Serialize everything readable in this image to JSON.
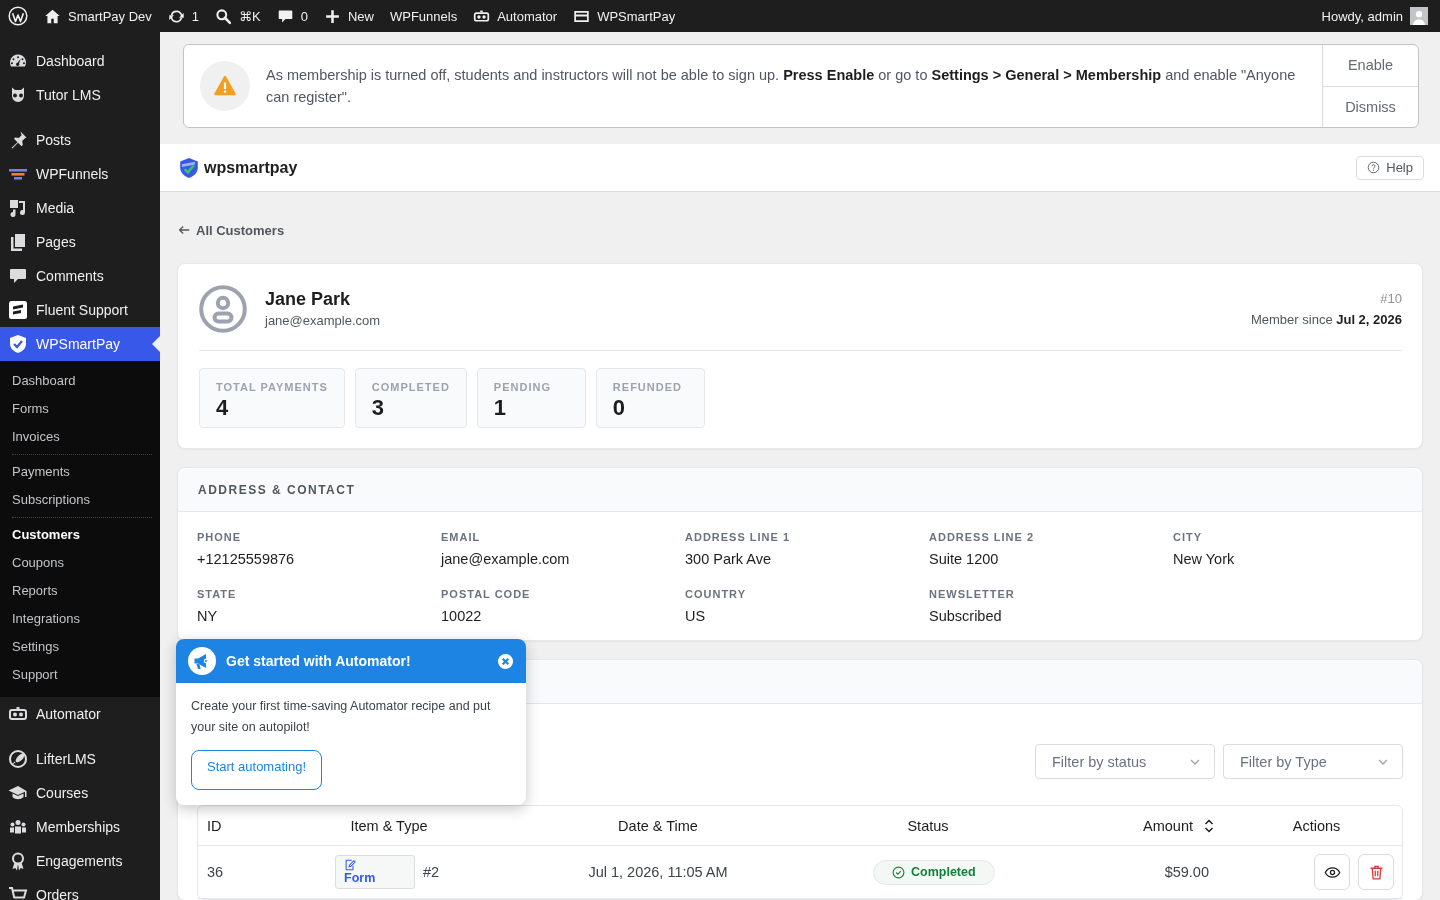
{
  "admin_bar": {
    "items": [
      {
        "label": "SmartPay Dev"
      },
      {
        "label": "1"
      },
      {
        "label": "⌘K"
      },
      {
        "label": "0"
      },
      {
        "label": "New"
      },
      {
        "label": "WPFunnels"
      },
      {
        "label": "Automator"
      },
      {
        "label": "WPSmartPay"
      }
    ],
    "account": "Howdy, admin"
  },
  "sidebar": {
    "groups": [
      {
        "items": [
          {
            "label": "Dashboard",
            "selected": false
          },
          {
            "label": "Tutor LMS",
            "selected": false
          }
        ]
      },
      {
        "items": [
          {
            "label": "Posts",
            "selected": false
          },
          {
            "label": "WPFunnels",
            "selected": false
          },
          {
            "label": "Media",
            "selected": false
          },
          {
            "label": "Pages",
            "selected": false
          },
          {
            "label": "Comments",
            "selected": false
          },
          {
            "label": "Fluent Support",
            "selected": false
          },
          {
            "label": "WPSmartPay",
            "selected": true,
            "children": [
              [
                {
                  "label": "Dashboard",
                  "selected": false
                },
                {
                  "label": "Forms",
                  "selected": false
                },
                {
                  "label": "Invoices",
                  "selected": false
                }
              ],
              [
                {
                  "label": "Payments",
                  "selected": false
                },
                {
                  "label": "Subscriptions",
                  "selected": false
                }
              ],
              [
                {
                  "label": "Customers",
                  "selected": true
                },
                {
                  "label": "Coupons",
                  "selected": false
                },
                {
                  "label": "Reports",
                  "selected": false
                },
                {
                  "label": "Integrations",
                  "selected": false
                },
                {
                  "label": "Settings",
                  "selected": false
                },
                {
                  "label": "Support",
                  "selected": false
                }
              ]
            ]
          },
          {
            "label": "Automator",
            "selected": false
          }
        ]
      },
      {
        "items": [
          {
            "label": "LifterLMS",
            "selected": false
          },
          {
            "label": "Courses",
            "selected": false
          },
          {
            "label": "Memberships",
            "selected": false
          },
          {
            "label": "Engagements",
            "selected": false
          },
          {
            "label": "Orders",
            "selected": false
          }
        ]
      }
    ]
  },
  "notice": {
    "message": "As membership is turned off, students and instructors will not be able to sign up. **Press Enable** or go to **Settings > General > Membership** and enable \"Anyone can register\".",
    "buttons": [
      "Enable",
      "Dismiss"
    ]
  },
  "page_header": {
    "logo_text": "wpsmartpay",
    "help": "Help"
  },
  "back_link": "All Customers",
  "customer": {
    "name": "Jane Park",
    "email": "jane@example.com",
    "number": "#10",
    "member_since": "Member since **Jul 2, 2026**",
    "stats": [
      {
        "label": "TOTAL PAYMENTS",
        "value": "4"
      },
      {
        "label": "COMPLETED",
        "value": "3"
      },
      {
        "label": "PENDING",
        "value": "1"
      },
      {
        "label": "REFUNDED",
        "value": "0"
      }
    ]
  },
  "address": {
    "title": "ADDRESS & CONTACT",
    "fields": [
      {
        "label": "PHONE",
        "value": "+12125559876"
      },
      {
        "label": "EMAIL",
        "value": "jane@example.com"
      },
      {
        "label": "ADDRESS LINE 1",
        "value": "300 Park Ave"
      },
      {
        "label": "ADDRESS LINE 2",
        "value": "Suite 1200"
      },
      {
        "label": "CITY",
        "value": "New York"
      },
      {
        "label": "STATE",
        "value": "NY"
      },
      {
        "label": "POSTAL CODE",
        "value": "10022"
      },
      {
        "label": "COUNTRY",
        "value": "US"
      },
      {
        "label": "NEWSLETTER",
        "value": "Subscribed"
      }
    ]
  },
  "payments": {
    "filters": [
      {
        "placeholder": "Filter by status"
      },
      {
        "placeholder": "Filter by Type"
      }
    ],
    "table": {
      "columns": [
        {
          "label": "ID",
          "sortable": false
        },
        {
          "label": "Item & Type",
          "sortable": false
        },
        {
          "label": "Date & Time",
          "sortable": false
        },
        {
          "label": "Status",
          "sortable": false
        },
        {
          "label": "Amount",
          "sortable": true
        },
        {
          "label": "Actions",
          "sortable": false
        }
      ],
      "rows": [
        {
          "id": "36",
          "type": "Form",
          "item": "#2",
          "date": "Jul 1, 2026, 11:05 AM",
          "status": "Completed",
          "amount": "$59.00"
        }
      ]
    }
  },
  "popover": {
    "title": "Get started with Automator!",
    "body": "Create your first time-saving Automator recipe and put your site on autopilot!",
    "button": "Start automating!"
  }
}
